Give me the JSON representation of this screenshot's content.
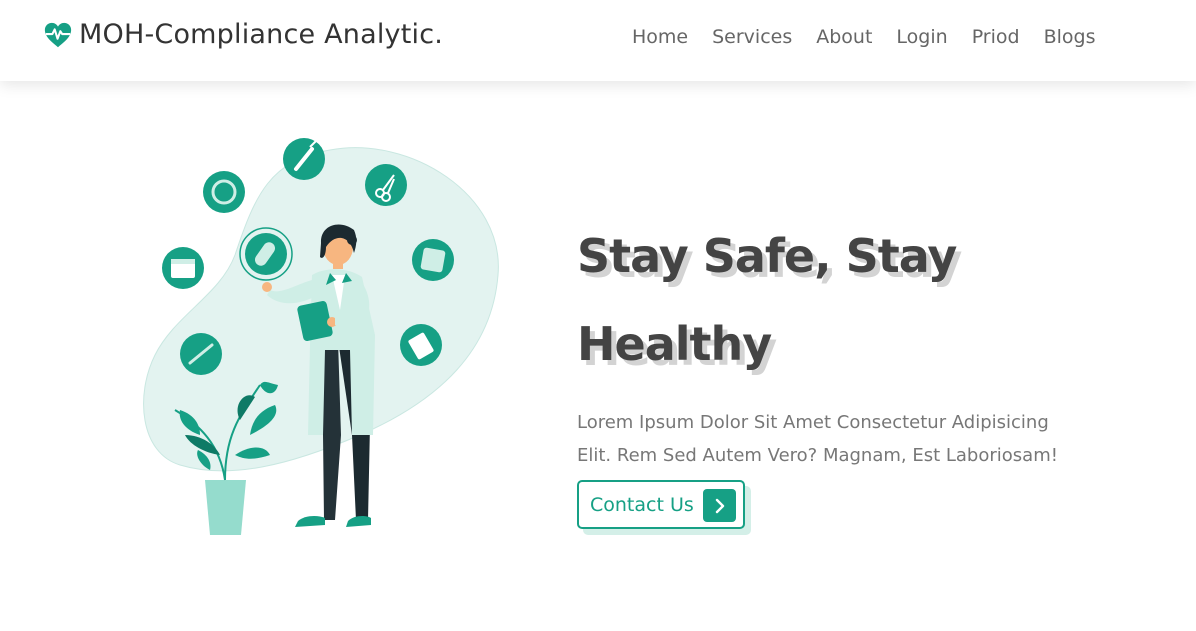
{
  "brand": {
    "name": "MOH-Compliance Analytic.",
    "icon": "heartbeat-icon",
    "accent_color": "#16a085"
  },
  "nav": {
    "items": [
      {
        "label": "Home"
      },
      {
        "label": "Services"
      },
      {
        "label": "About"
      },
      {
        "label": "Login"
      },
      {
        "label": "Priod"
      },
      {
        "label": "Blogs"
      }
    ]
  },
  "hero": {
    "headline_line1": "Stay Safe, Stay",
    "headline_line2": "Healthy",
    "description": "Lorem Ipsum Dolor Sit Amet Consectetur Adipisicing Elit. Rem Sed Autem Vero? Magnam, Est Laboriosam!",
    "cta_label": "Contact Us",
    "cta_icon": "chevron-right-icon",
    "illustration": "doctor-with-medical-icons-illustration"
  }
}
